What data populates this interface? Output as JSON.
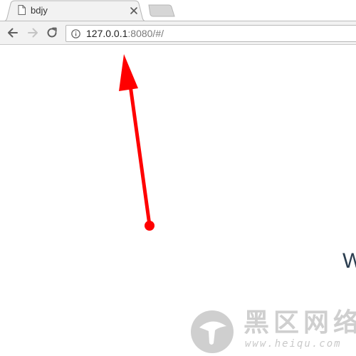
{
  "browser": {
    "tab": {
      "title": "bdjy",
      "favicon": "document-icon",
      "close_icon": "close-icon"
    },
    "new_tab_icon": "new-tab-icon",
    "toolbar": {
      "back_icon": "back-arrow-icon",
      "forward_icon": "forward-arrow-icon",
      "reload_icon": "reload-icon"
    },
    "address_bar": {
      "security_icon": "info-icon",
      "url_host": "127.0.0.1",
      "url_rest": ":8080/#/"
    }
  },
  "page": {
    "heading_partial": "W"
  },
  "annotation": {
    "type": "arrow",
    "color": "#ff0000",
    "points_to": "address-bar"
  },
  "watermark": {
    "text_cn": "黑区网络",
    "url": "www.heiqu.com"
  }
}
